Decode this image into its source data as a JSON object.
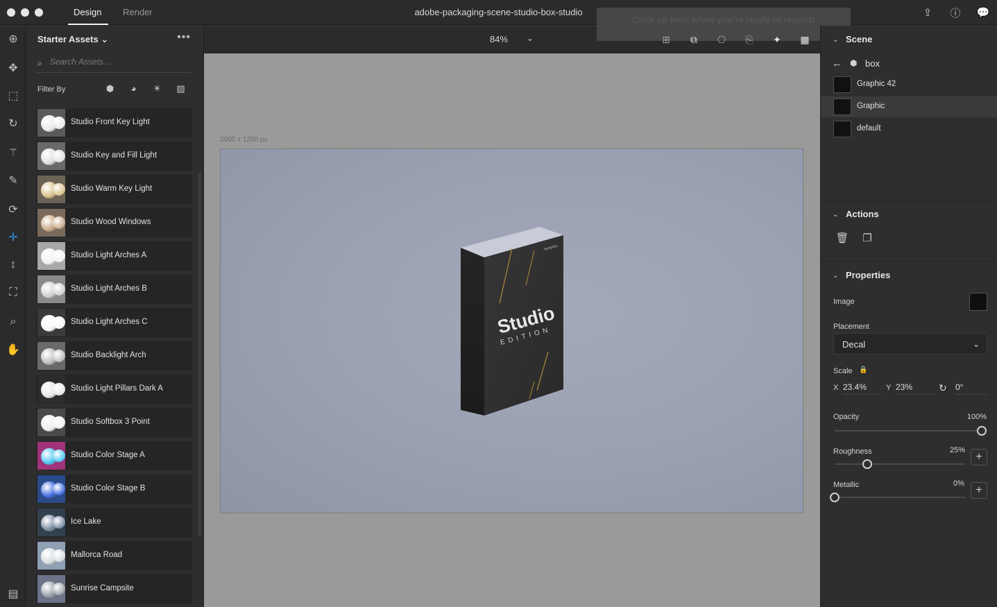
{
  "titlebar": {
    "tabs": [
      {
        "label": "Design"
      },
      {
        "label": "Render"
      }
    ],
    "document_title": "adobe-packaging-scene-studio-box-studio",
    "icons": [
      "share-icon",
      "help-icon",
      "feedback-icon"
    ]
  },
  "toolbar": {
    "tools": [
      "add-icon",
      "move-icon",
      "scale-icon",
      "rotate-icon",
      "magic-wand-icon",
      "eyedropper-icon",
      "orbit-icon",
      "pan-icon",
      "dolly-icon",
      "frame-icon",
      "zoom-icon",
      "hand-icon"
    ],
    "selected_tool": "pan-icon"
  },
  "assets": {
    "header": "Starter Assets",
    "more": "•••",
    "search_placeholder": "Search Assets...",
    "filter_label": "Filter By",
    "items": [
      {
        "label": "Studio Front Key Light",
        "ball": "#e8e8e8",
        "bg": "#5a5a5a"
      },
      {
        "label": "Studio Key and Fill Light",
        "ball": "#e0e0e0",
        "bg": "#6a6a6a"
      },
      {
        "label": "Studio Warm Key Light",
        "ball": "#d8c08a",
        "bg": "#6b6356"
      },
      {
        "label": "Studio Wood Windows",
        "ball": "#c9a98a",
        "bg": "#7a6a5c"
      },
      {
        "label": "Studio Light Arches A",
        "ball": "#f0f0f0",
        "bg": "#a8a8a8"
      },
      {
        "label": "Studio Light Arches B",
        "ball": "#cfcfcf",
        "bg": "#8a8a8a"
      },
      {
        "label": "Studio Light Arches C",
        "ball": "#f5f5f5",
        "bg": "#3a3a3a"
      },
      {
        "label": "Studio Backlight Arch",
        "ball": "#bdbdbd",
        "bg": "#6a6a6a"
      },
      {
        "label": "Studio Light Pillars Dark A",
        "ball": "#e6e6e6",
        "bg": "#2c2c2c"
      },
      {
        "label": "Studio Softbox 3 Point",
        "ball": "#ededed",
        "bg": "#4a4a4a"
      },
      {
        "label": "Studio Color Stage A",
        "ball": "#4cc6f0",
        "bg": "#a0337a"
      },
      {
        "label": "Studio Color Stage B",
        "ball": "#3f6be0",
        "bg": "#2a4a8a"
      },
      {
        "label": "Ice Lake",
        "ball": "#7a8aa0",
        "bg": "#33404e"
      },
      {
        "label": "Mallorca Road",
        "ball": "#d9dde2",
        "bg": "#8fa0b2"
      },
      {
        "label": "Sunrise Campsite",
        "ball": "#9aa0a8",
        "bg": "#6b7488"
      }
    ]
  },
  "canvas": {
    "zoom": "84%",
    "record_hint": "Click up here when you're ready to record!",
    "dimensions": "2000 x 1250 px",
    "box": {
      "logo_word": "Studio",
      "sub_word": "EDITION",
      "brand": "Samplico"
    }
  },
  "scene": {
    "header": "Scene",
    "back_label": "box",
    "layers": [
      {
        "label": "Graphic 42"
      },
      {
        "label": "Graphic"
      },
      {
        "label": "default"
      }
    ]
  },
  "actions": {
    "header": "Actions"
  },
  "properties": {
    "header": "Properties",
    "image_label": "Image",
    "placement_label": "Placement",
    "placement_value": "Decal",
    "scale_label": "Scale",
    "scale_x_label": "X",
    "scale_x": "23.4%",
    "scale_y_label": "Y",
    "scale_y": "23%",
    "rotation": "0°",
    "opacity_label": "Opacity",
    "opacity_value": "100%",
    "opacity": 1.0,
    "roughness_label": "Roughness",
    "roughness_value": "25%",
    "roughness": 0.25,
    "metallic_label": "Metallic",
    "metallic_value": "0%",
    "metallic": 0.0
  },
  "colors": {
    "accent": "#2d8ceb"
  }
}
